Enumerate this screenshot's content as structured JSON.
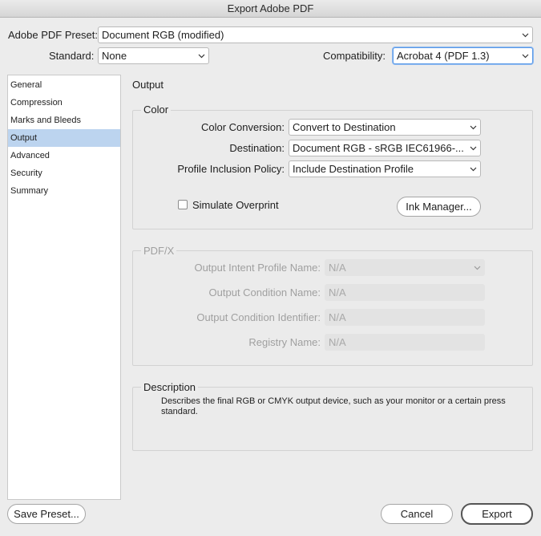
{
  "window": {
    "title": "Export Adobe PDF"
  },
  "header": {
    "preset_label": "Adobe PDF Preset:",
    "preset_value": "Document RGB (modified)",
    "standard_label": "Standard:",
    "standard_value": "None",
    "compatibility_label": "Compatibility:",
    "compatibility_value": "Acrobat 4 (PDF 1.3)"
  },
  "sidebar": {
    "items": [
      {
        "label": "General"
      },
      {
        "label": "Compression"
      },
      {
        "label": "Marks and Bleeds"
      },
      {
        "label": "Output"
      },
      {
        "label": "Advanced"
      },
      {
        "label": "Security"
      },
      {
        "label": "Summary"
      }
    ],
    "selected": "Output"
  },
  "main": {
    "section_title": "Output",
    "color": {
      "title": "Color",
      "conversion_label": "Color Conversion:",
      "conversion_value": "Convert to Destination",
      "destination_label": "Destination:",
      "destination_value": "Document RGB - sRGB IEC61966-...",
      "profile_label": "Profile Inclusion Policy:",
      "profile_value": "Include Destination Profile",
      "simulate_label": "Simulate Overprint",
      "simulate_checked": false,
      "ink_manager_label": "Ink Manager..."
    },
    "pdfx": {
      "title": "PDF/X",
      "intent_label": "Output Intent Profile Name:",
      "intent_value": "N/A",
      "condition_name_label": "Output Condition Name:",
      "condition_name_value": "N/A",
      "condition_id_label": "Output Condition Identifier:",
      "condition_id_value": "N/A",
      "registry_label": "Registry Name:",
      "registry_value": "N/A"
    },
    "description": {
      "title": "Description",
      "text_line1": "Describes the final RGB or CMYK output device, such as your monitor or a certain press",
      "text_line2": "standard."
    }
  },
  "footer": {
    "save_preset_label": "Save Preset...",
    "cancel_label": "Cancel",
    "export_label": "Export"
  },
  "colors": {
    "selection": "#bcd4ef",
    "focus": "#5b9ae8",
    "disabled_field": "#e3e3e3"
  }
}
